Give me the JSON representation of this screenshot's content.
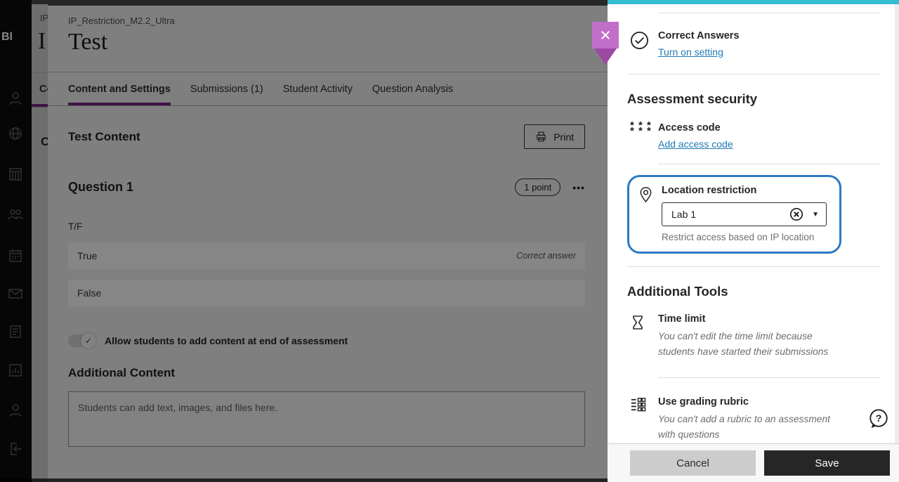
{
  "colors": {
    "accent_purple": "#772583",
    "link_blue": "#1e7ab5",
    "highlight_blue": "#2b7bc2",
    "panel_top_teal": "#35bdd1",
    "close_purple": "#c26fc9"
  },
  "sidebar": {
    "logo": "Bl",
    "icons": [
      "profile",
      "globe",
      "institution",
      "groups",
      "calendar",
      "messages",
      "activity-stream",
      "grades",
      "admin",
      "sign-out"
    ]
  },
  "back_panel_fragments": {
    "course_id": "IP",
    "title": "I",
    "tab": "Co",
    "content": "C"
  },
  "main": {
    "course_id": "IP_Restriction_M2.2_Ultra",
    "title": "Test",
    "tabs": [
      {
        "label": "Content and Settings",
        "active": true
      },
      {
        "label": "Submissions (1)",
        "active": false
      },
      {
        "label": "Student Activity",
        "active": false
      },
      {
        "label": "Question Analysis",
        "active": false
      }
    ],
    "content": {
      "heading": "Test Content",
      "print_label": "Print",
      "question": {
        "title": "Question 1",
        "points_label": "1 point",
        "menu_label": "•••",
        "prompt": "T/F",
        "answers": [
          {
            "label": "True",
            "note": "Correct answer"
          },
          {
            "label": "False",
            "note": ""
          }
        ]
      },
      "toggle_label": "Allow students to add content at end of assessment",
      "toggle_check": "✓",
      "additional_heading": "Additional Content",
      "editor_placeholder": "Students can add text, images, and files here."
    }
  },
  "panel": {
    "close_label": "×",
    "correct_answers": {
      "title": "Correct Answers",
      "link": "Turn on setting"
    },
    "security": {
      "heading": "Assessment security",
      "access_code": {
        "title": "Access code",
        "link": "Add access code",
        "icon_glyph": "* * *"
      },
      "location": {
        "title": "Location restriction",
        "value": "Lab 1",
        "helper": "Restrict access based on IP location"
      }
    },
    "tools": {
      "heading": "Additional Tools",
      "time_limit": {
        "title": "Time limit",
        "note": "You can't edit the time limit because students have started their submissions"
      },
      "rubric": {
        "title": "Use grading rubric",
        "note": "You can't add a rubric to an assessment with questions"
      }
    },
    "help_label": "?",
    "footer": {
      "cancel": "Cancel",
      "save": "Save"
    }
  }
}
